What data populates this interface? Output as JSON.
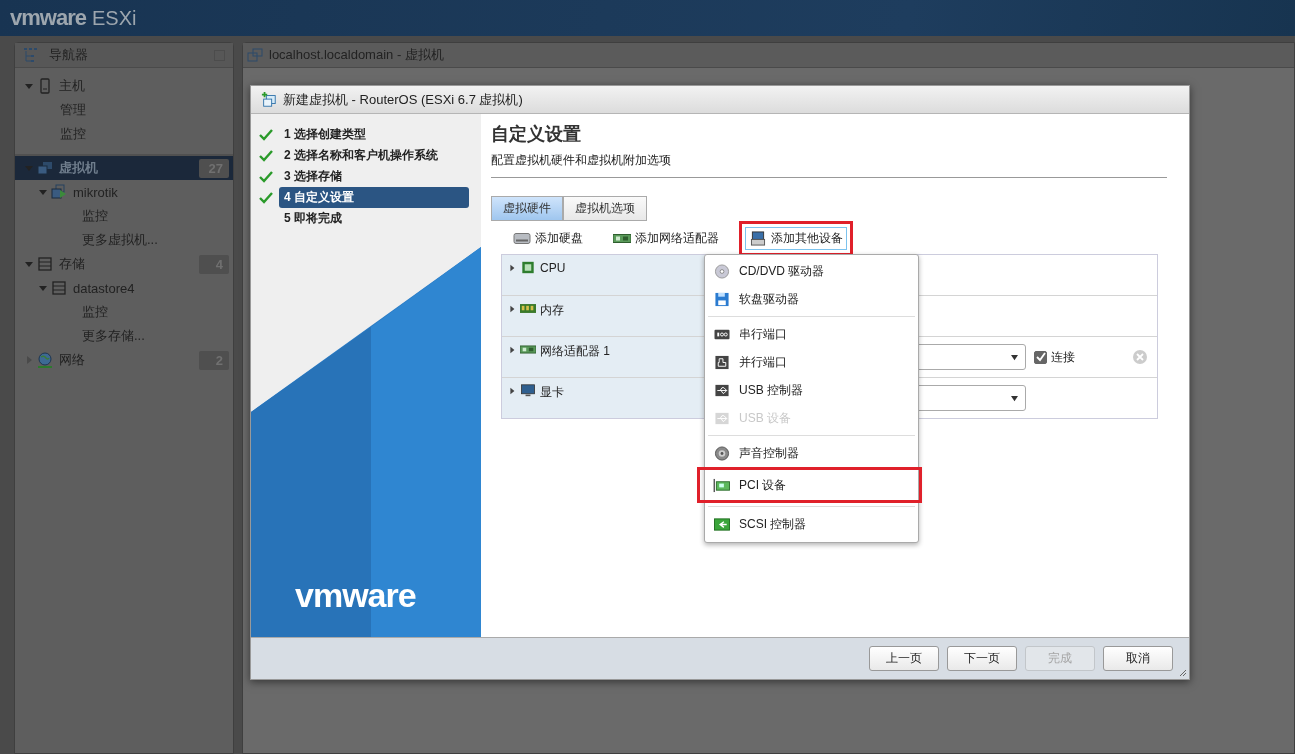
{
  "app": {
    "brand": "vmware",
    "product": "ESXi"
  },
  "navigator": {
    "title": "导航器",
    "items": [
      {
        "label": "主机",
        "kind": "host",
        "expanded": true,
        "selected": false,
        "children": [
          {
            "label": "管理",
            "kind": "page",
            "selected": false
          },
          {
            "label": "监控",
            "kind": "page",
            "selected": false
          }
        ]
      },
      {
        "label": "虚拟机",
        "kind": "vms",
        "expanded": true,
        "selected": true,
        "count": "27",
        "children": [
          {
            "label": "mikrotik",
            "kind": "vm",
            "expanded": true,
            "selected": false,
            "children": [
              {
                "label": "监控",
                "kind": "page",
                "selected": false
              },
              {
                "label": "更多虚拟机...",
                "kind": "page",
                "selected": false
              }
            ]
          }
        ]
      },
      {
        "label": "存储",
        "kind": "storage",
        "expanded": true,
        "selected": false,
        "count": "4",
        "children": [
          {
            "label": "datastore4",
            "kind": "datastore",
            "expanded": true,
            "selected": false,
            "children": [
              {
                "label": "监控",
                "kind": "page",
                "selected": false
              },
              {
                "label": "更多存储...",
                "kind": "page",
                "selected": false
              }
            ]
          }
        ]
      },
      {
        "label": "网络",
        "kind": "network",
        "expanded": false,
        "selected": false,
        "count": "2"
      }
    ]
  },
  "main_panel": {
    "title": "localhost.localdomain - 虚拟机"
  },
  "dialog": {
    "title": "新建虚拟机 - RouterOS (ESXi 6.7 虚拟机)",
    "steps": [
      {
        "label": "1 选择创建类型",
        "done": true,
        "selected": false
      },
      {
        "label": "2 选择名称和客户机操作系统",
        "done": true,
        "selected": false
      },
      {
        "label": "3 选择存储",
        "done": true,
        "selected": false
      },
      {
        "label": "4 自定义设置",
        "done": true,
        "selected": true
      },
      {
        "label": "5 即将完成",
        "done": false,
        "selected": false
      }
    ],
    "brand": "vmware",
    "heading": "自定义设置",
    "subtitle": "配置虚拟机硬件和虚拟机附加选项",
    "tabs": [
      {
        "label": "虚拟硬件",
        "selected": true
      },
      {
        "label": "虚拟机选项",
        "selected": false
      }
    ],
    "toolbar": [
      {
        "label": "添加硬盘",
        "kind": "disk",
        "active": false,
        "highlighted": false
      },
      {
        "label": "添加网络适配器",
        "kind": "nic",
        "active": false,
        "highlighted": false
      },
      {
        "label": "添加其他设备",
        "kind": "other",
        "active": true,
        "highlighted": true
      }
    ],
    "hardware": [
      {
        "name": "CPU",
        "kind": "cpu",
        "dropdown": false,
        "removable": false
      },
      {
        "name": "内存",
        "kind": "memory",
        "dropdown": false,
        "removable": false
      },
      {
        "name": "网络适配器 1",
        "kind": "nic",
        "dropdown": true,
        "connect": {
          "label": "连接",
          "checked": true
        },
        "removable": true
      },
      {
        "name": "显卡",
        "kind": "video",
        "dropdown": true,
        "removable": false
      }
    ],
    "menu": {
      "groups": [
        [
          {
            "label": "CD/DVD 驱动器",
            "kind": "cdrom",
            "disabled": false,
            "highlighted": false
          },
          {
            "label": "软盘驱动器",
            "kind": "floppy",
            "disabled": false,
            "highlighted": false
          }
        ],
        [
          {
            "label": "串行端口",
            "kind": "serial",
            "disabled": false,
            "highlighted": false
          },
          {
            "label": "并行端口",
            "kind": "parallel",
            "disabled": false,
            "highlighted": false
          },
          {
            "label": "USB 控制器",
            "kind": "usb",
            "disabled": false,
            "highlighted": false
          },
          {
            "label": "USB 设备",
            "kind": "usbdev",
            "disabled": true,
            "highlighted": false
          }
        ],
        [
          {
            "label": "声音控制器",
            "kind": "sound",
            "disabled": false,
            "highlighted": false
          },
          {
            "label": "PCI 设备",
            "kind": "pci",
            "disabled": false,
            "highlighted": true
          }
        ],
        [
          {
            "label": "SCSI 控制器",
            "kind": "scsi",
            "disabled": false,
            "highlighted": false
          }
        ]
      ]
    },
    "buttons": [
      {
        "label": "上一页",
        "disabled": false
      },
      {
        "label": "下一页",
        "disabled": false
      },
      {
        "label": "完成",
        "disabled": true
      },
      {
        "label": "取消",
        "disabled": false
      }
    ]
  }
}
